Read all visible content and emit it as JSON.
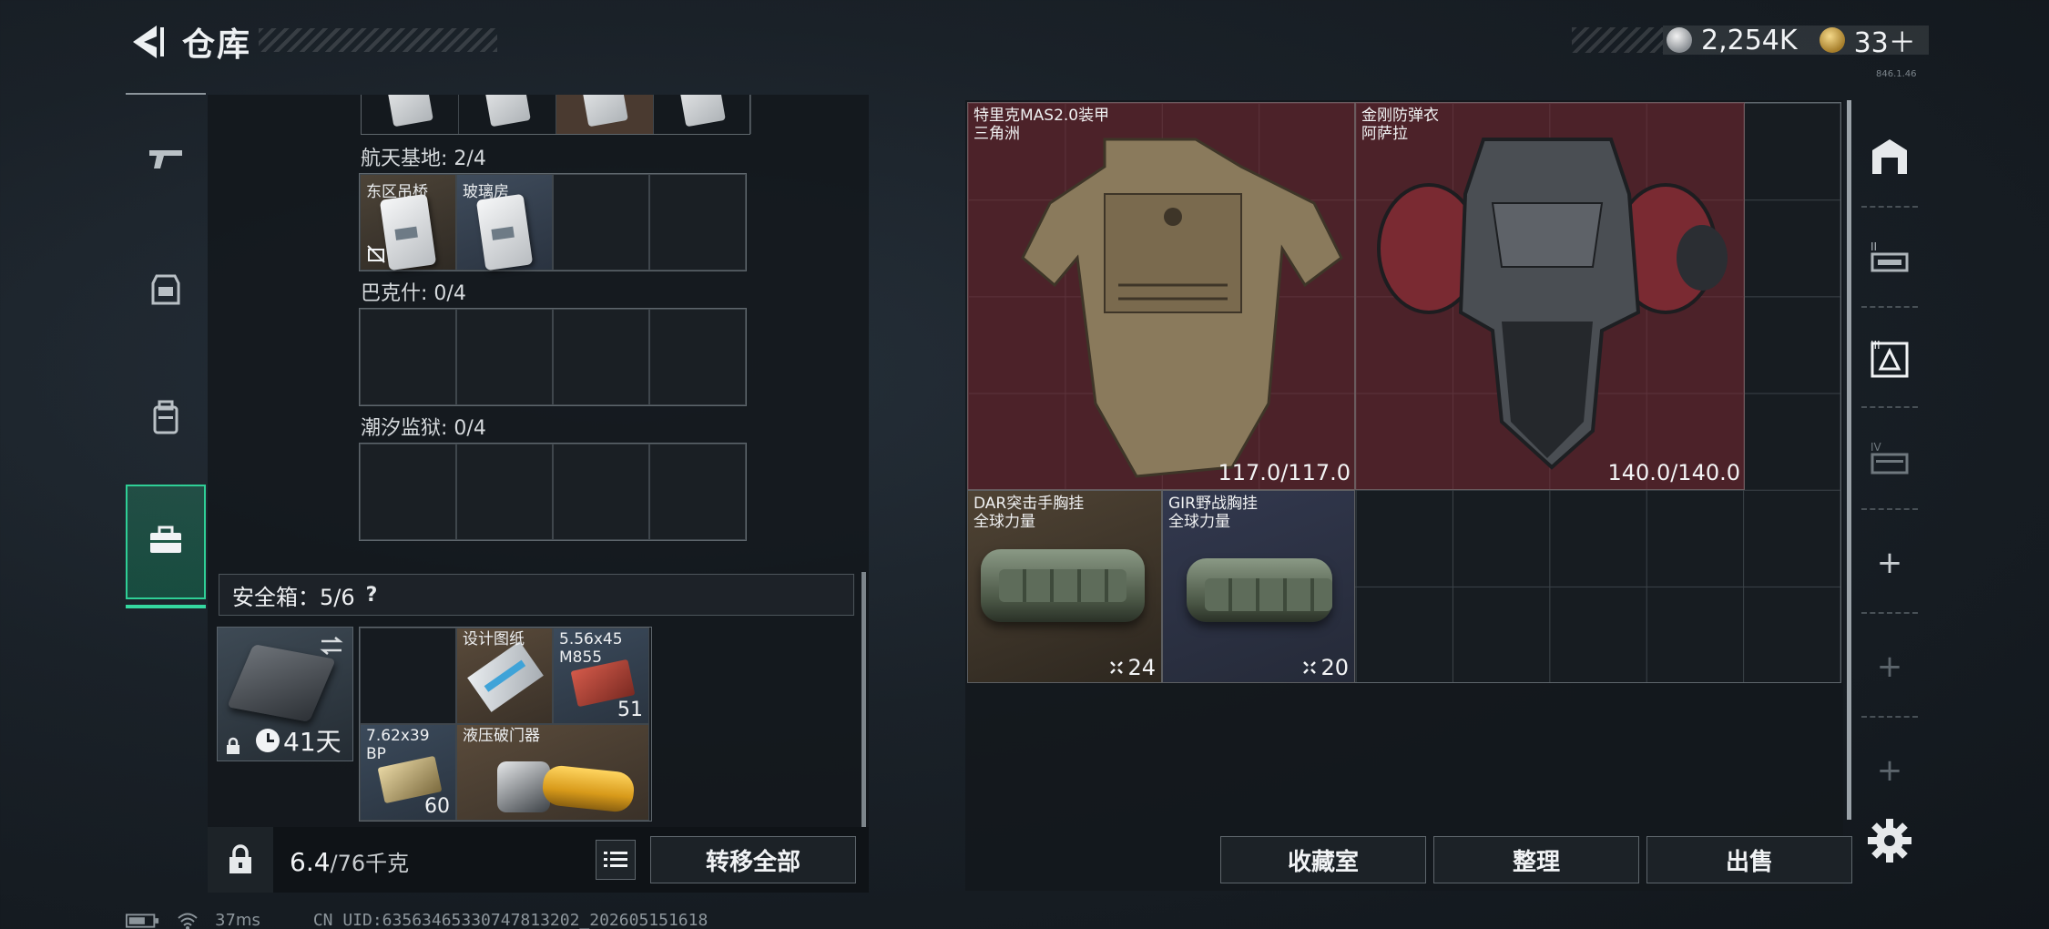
{
  "header": {
    "title": "仓库",
    "currency_silver": "2,254K",
    "currency_gold": "33＋",
    "tiny_version": "846.1.46"
  },
  "left_nav": {
    "items": [
      {
        "name": "weapons",
        "icon": "pistol-icon"
      },
      {
        "name": "equipment",
        "icon": "helmet-icon"
      },
      {
        "name": "backpack",
        "icon": "backpack-icon"
      },
      {
        "name": "toolbox",
        "icon": "toolbox-icon",
        "active": true
      }
    ]
  },
  "collections": {
    "s1_label": "航天基地: 2/4",
    "s1_items": [
      "东区吊桥",
      "玻璃房"
    ],
    "s2_label": "巴克什: 0/4",
    "s3_label": "潮汐监狱: 0/4"
  },
  "safebox": {
    "label": "安全箱：5/6",
    "help": "?",
    "days": "41天",
    "items": [
      {
        "name": "",
        "qty": ""
      },
      {
        "name": "设计图纸",
        "qty": ""
      },
      {
        "name": "5.56x45\nM855",
        "qty": "51"
      },
      {
        "name": "7.62x39\nBP",
        "qty": "60"
      },
      {
        "name": "液压破门器",
        "qty": ""
      }
    ]
  },
  "footer_left": {
    "weight_value": "6.4",
    "weight_max": "/76千克",
    "transfer_all": "转移全部"
  },
  "stash": {
    "armors": [
      {
        "name1": "特里克MAS2.0装甲",
        "name2": "三角洲",
        "durability": "117.0/117.0"
      },
      {
        "name1": "金刚防弹衣",
        "name2": "阿萨拉",
        "durability": "140.0/140.0"
      }
    ],
    "rigs": [
      {
        "name1": "DAR突击手胸挂",
        "name2": "全球力量",
        "capacity": "24"
      },
      {
        "name1": "GIR野战胸挂",
        "name2": "全球力量",
        "capacity": "20"
      }
    ]
  },
  "footer_right": {
    "collection_room": "收藏室",
    "sort": "整理",
    "sell": "出售"
  },
  "status_bar": {
    "ping": "37ms",
    "uid": "CN UID:6356346533074781​3202_202605151618"
  },
  "colors": {
    "accent_green": "#2fcf96",
    "armor_red": "#7a2832",
    "panel": "#13181d"
  }
}
